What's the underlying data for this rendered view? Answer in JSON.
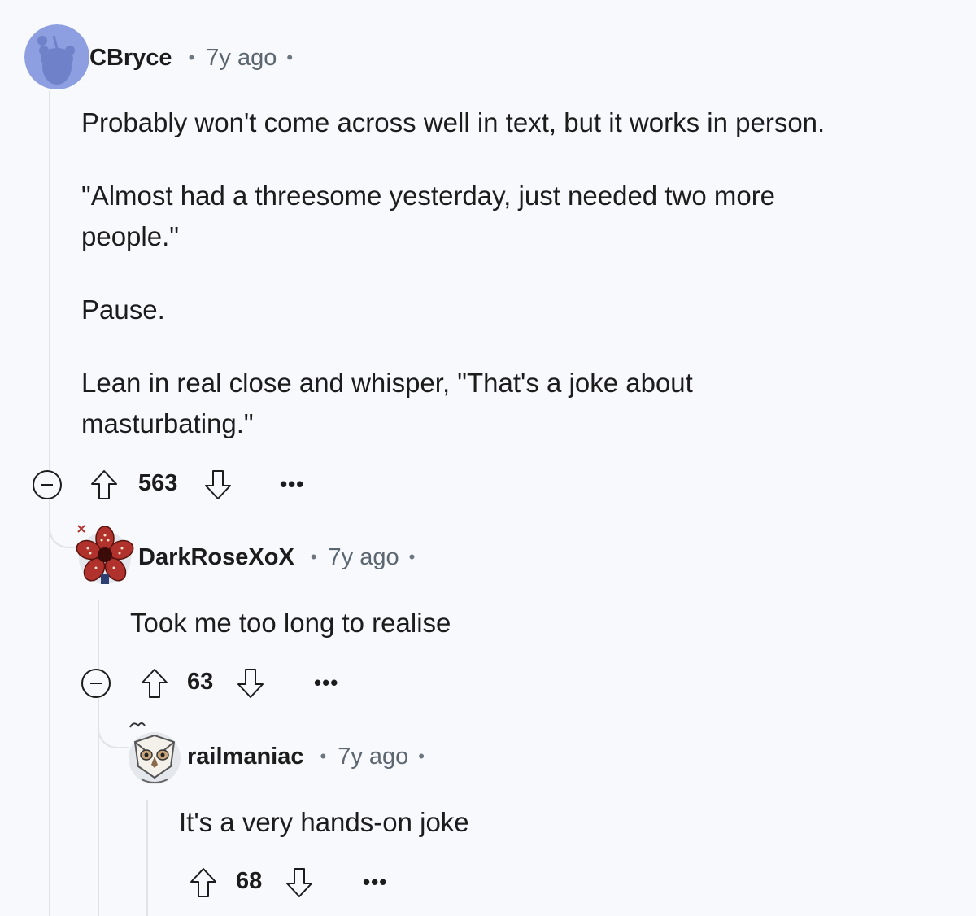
{
  "comments": [
    {
      "author": "CBryce",
      "time": "7y ago",
      "paragraphs": [
        "Probably won't come across well in text, but it works in person.",
        "\"Almost had a threesome yesterday, just needed two more people.\"",
        "Pause.",
        "Lean in real close and whisper, \"That's a joke about masturbating.\""
      ],
      "score": "563"
    },
    {
      "author": "DarkRoseXoX",
      "time": "7y ago",
      "paragraphs": [
        "Took me too long to realise"
      ],
      "score": "63"
    },
    {
      "author": "railmaniac",
      "time": "7y ago",
      "paragraphs": [
        "It's a very hands-on joke"
      ],
      "score": "68"
    }
  ],
  "separator": "•",
  "more_label": "•••",
  "colors": {
    "background": "#f7f9fc",
    "thread_line": "#dfe3e8",
    "avatar_default": "#8d9fe0"
  },
  "icons": {
    "upvote": "upvote-arrow-icon",
    "downvote": "downvote-arrow-icon",
    "collapse": "collapse-minus-icon",
    "more": "more-options-icon"
  }
}
